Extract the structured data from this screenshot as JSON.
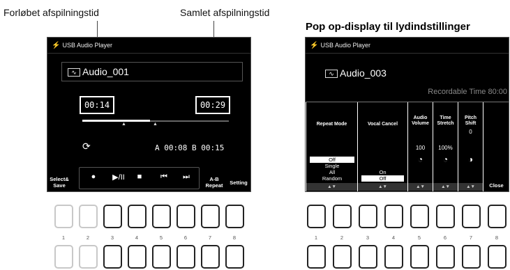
{
  "annotations": {
    "elapsed_label": "Forløbet afspilningstid",
    "total_label": "Samlet afspilningstid",
    "popup_title": "Pop op-display til lydindstillinger"
  },
  "left_screen": {
    "title": "USB Audio Player",
    "song_name": "Audio_001",
    "elapsed_time": "00:14",
    "total_time": "00:29",
    "progress": 0.46,
    "ab_text": "A 00:08  B 00:15",
    "select_save_label": "Select&\nSave",
    "ab_repeat_label": "A-B\nRepeat",
    "setting_label": "Setting",
    "controls": {
      "record": "●",
      "play_pause": "▶/II",
      "stop": "■",
      "rewind": "⏮",
      "forward": "⏭"
    }
  },
  "right_screen": {
    "title": "USB Audio Player",
    "song_name": "Audio_003",
    "recordable_time": "Recordable Time 80:00",
    "columns": {
      "repeat_mode": "Repeat Mode",
      "vocal_cancel": "Vocal Cancel",
      "audio_volume": "Audio\nVolume",
      "time_stretch": "Time\nStretch",
      "pitch_shift": "Pitch\nShift"
    },
    "repeat_options": [
      "Off",
      "Single",
      "All",
      "Random"
    ],
    "repeat_selected": "Off",
    "vocal_options": [
      "On",
      "Off"
    ],
    "vocal_selected": "Off",
    "audio_volume_value": "100",
    "time_stretch_value": "100%",
    "pitch_shift_value": "0",
    "close_label": "Close",
    "arrows": "▲▼"
  },
  "button_numbers": [
    "1",
    "2",
    "3",
    "4",
    "5",
    "6",
    "7",
    "8"
  ]
}
